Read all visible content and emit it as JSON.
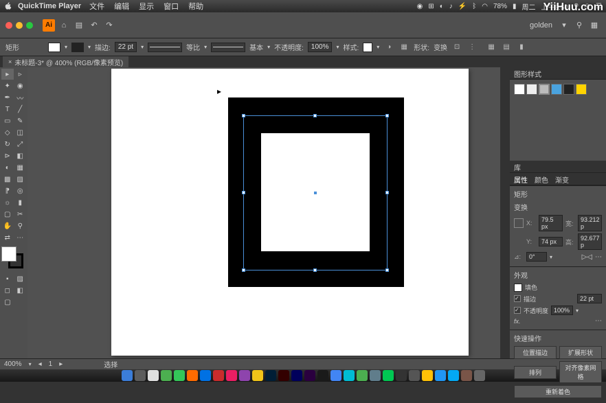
{
  "menubar": {
    "app": "QuickTime Player",
    "items": [
      "文件",
      "编辑",
      "显示",
      "窗口",
      "帮助"
    ],
    "battery": "78%",
    "day": "周二",
    "time": "上午8:50"
  },
  "topbar": {
    "user": "golden"
  },
  "options": {
    "title": "矩形",
    "stroke_label": "描边:",
    "stroke_val": "22 pt",
    "uniform": "等比",
    "basic": "基本",
    "opacity_label": "不透明度:",
    "opacity_val": "100%",
    "style_label": "样式:",
    "shape_label": "形状:",
    "transform_label": "变换"
  },
  "tab": {
    "name": "未标题-3* @ 400% (RGB/像素预览)"
  },
  "rightpanel": {
    "styles_title": "图形样式",
    "properties_tab": "属性",
    "lib_tab": "库",
    "color_tab": "颜色",
    "gradient_tab": "渐变",
    "shape_section": "矩形",
    "transform_section": "变换",
    "x_val": "79.5 px",
    "w_val": "93.212 p",
    "y_val": "74 px",
    "h_val": "92.677 p",
    "rotate_val": "0°",
    "appearance": "外观",
    "fill_label": "填色",
    "stroke_label": "描边",
    "stroke_val": "22 pt",
    "opacity_label": "不透明度",
    "opacity_val": "100%",
    "quick_title": "快速操作",
    "btn1": "位置描边",
    "btn2": "扩展形状",
    "btn3": "排列",
    "btn4": "对齐像素网格",
    "recolor": "重新着色"
  },
  "status": {
    "zoom": "400%",
    "nav": "选择"
  },
  "watermark": "YiiHuu.com",
  "chart_data": null
}
